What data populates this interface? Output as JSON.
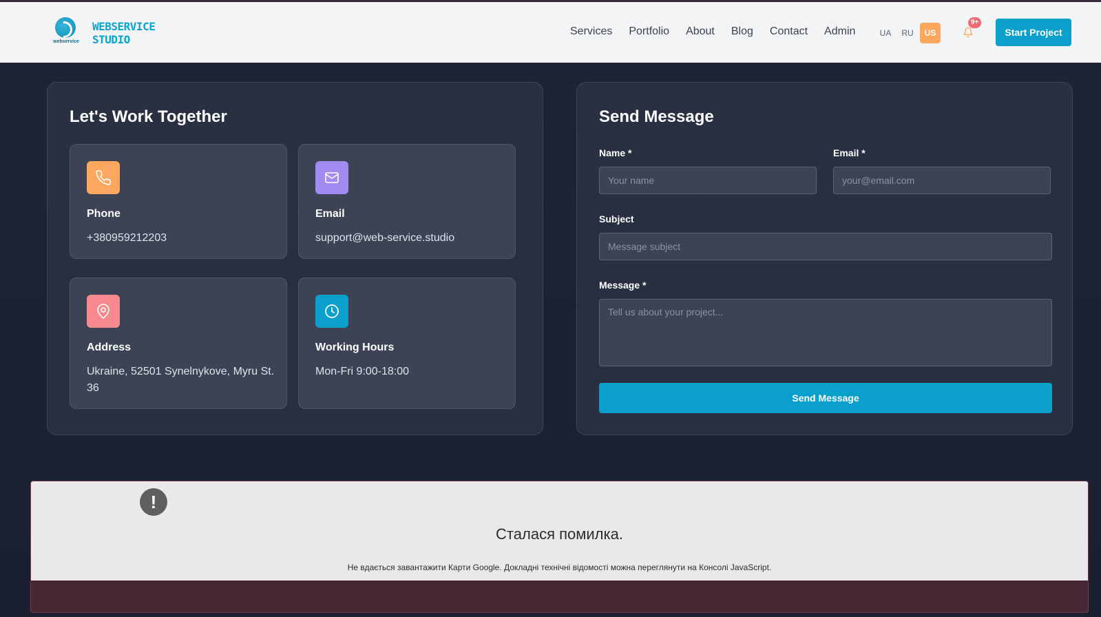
{
  "header": {
    "logo_line1": "WEBSERVICE",
    "logo_line2": "STUDIO",
    "logo_sub": "webservice",
    "nav": [
      "Services",
      "Portfolio",
      "About",
      "Blog",
      "Contact",
      "Admin"
    ],
    "languages": [
      "UA",
      "RU",
      "US"
    ],
    "active_language": "US",
    "notification_badge": "9+",
    "start_button": "Start Project"
  },
  "contact_info": {
    "title": "Let's Work Together",
    "cards": [
      {
        "title": "Phone",
        "value": "+380959212203",
        "icon": "phone-icon",
        "color": "#fba85e"
      },
      {
        "title": "Email",
        "value": "support@web-service.studio",
        "icon": "mail-icon",
        "color": "#a08cf0"
      },
      {
        "title": "Address",
        "value": "Ukraine, 52501 Synelnykove, Myru St. 36",
        "icon": "map-pin-icon",
        "color": "#f68a8e"
      },
      {
        "title": "Working Hours",
        "value": "Mon-Fri 9:00-18:00",
        "icon": "clock-icon",
        "color": "#0ba0cb"
      }
    ]
  },
  "form": {
    "title": "Send Message",
    "name_label": "Name *",
    "name_placeholder": "Your name",
    "email_label": "Email *",
    "email_placeholder": "your@email.com",
    "subject_label": "Subject",
    "subject_placeholder": "Message subject",
    "message_label": "Message *",
    "message_placeholder": "Tell us about your project...",
    "send_button": "Send Message"
  },
  "map_error": {
    "icon": "!",
    "title": "Сталася помилка.",
    "text": "Не вдається завантажити Карти Google. Докладні технічні відомості можна переглянути на Консолі JavaScript."
  }
}
